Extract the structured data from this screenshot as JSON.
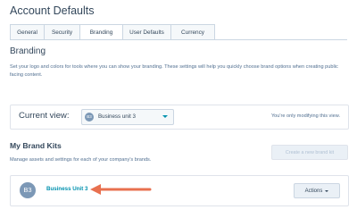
{
  "page": {
    "title": "Account Defaults"
  },
  "tabs": [
    {
      "label": "General",
      "active": false
    },
    {
      "label": "Security",
      "active": false
    },
    {
      "label": "Branding",
      "active": true
    },
    {
      "label": "User Defaults",
      "active": false
    },
    {
      "label": "Currency",
      "active": false
    }
  ],
  "branding": {
    "heading": "Branding",
    "description": "Set your logo and colors for tools where you can show your branding. These settings will help you quickly choose brand options when creating public facing content."
  },
  "current_view": {
    "label": "Current view:",
    "badge": "B3",
    "selected": "Business unit 3",
    "note": "You're only modifying this view."
  },
  "brand_kits": {
    "heading": "My Brand Kits",
    "description": "Manage assets and settings for each of your company's brands.",
    "create_label": "Create a new brand kit",
    "kit": {
      "avatar": "B3",
      "name": "Business Unit 3",
      "actions_label": "Actions"
    }
  },
  "colors": {
    "accent": "#0091ae",
    "arrow": "#e8704f",
    "border": "#cbd6e2",
    "text": "#33475b"
  },
  "icons": {
    "arrow": "arrow-left-icon",
    "caret": "chevron-down-icon"
  }
}
